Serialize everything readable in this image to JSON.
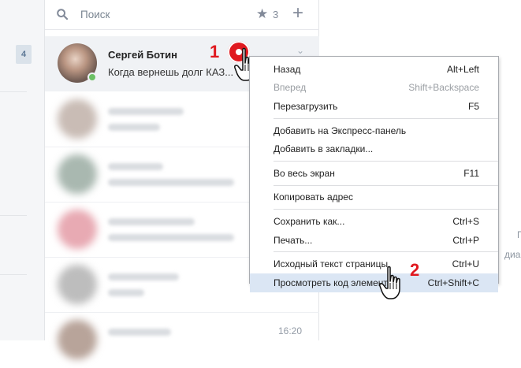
{
  "leftnav": {
    "badge": "4"
  },
  "search": {
    "placeholder": "Поиск",
    "favorites_count": "3"
  },
  "active_dialog": {
    "name": "Сергей Ботин",
    "message": "Когда вернешь долг КАЗ..."
  },
  "dialogs_time": "16:20",
  "markers": {
    "one": "1",
    "two": "2"
  },
  "context_menu": {
    "items": [
      {
        "label": "Назад",
        "shortcut": "Alt+Left"
      },
      {
        "label": "Вперед",
        "shortcut": "Shift+Backspace"
      },
      {
        "label": "Перезагрузить",
        "shortcut": "F5"
      },
      {
        "label": "Добавить на Экспресс-панель",
        "shortcut": ""
      },
      {
        "label": "Добавить в закладки...",
        "shortcut": ""
      },
      {
        "label": "Во весь экран",
        "shortcut": "F11"
      },
      {
        "label": "Копировать адрес",
        "shortcut": ""
      },
      {
        "label": "Сохранить как...",
        "shortcut": "Ctrl+S"
      },
      {
        "label": "Печать...",
        "shortcut": "Ctrl+P"
      },
      {
        "label": "Исходный текст страницы",
        "shortcut": "Ctrl+U"
      },
      {
        "label": "Просмотреть код элемента",
        "shortcut": "Ctrl+Shift+C"
      }
    ]
  },
  "rightpane": {
    "line1": "П",
    "line2": "диа"
  }
}
